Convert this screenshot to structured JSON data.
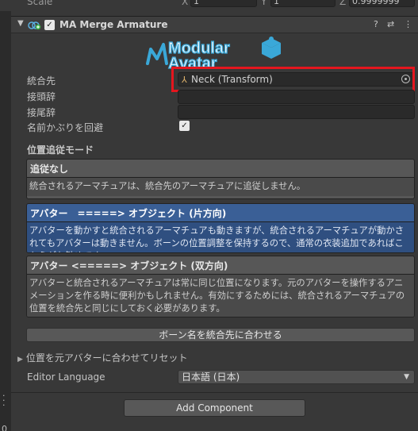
{
  "transform": {
    "scale_label": "Scale",
    "x_label": "X",
    "x_value": "1",
    "y_label": "Y",
    "y_value": "1",
    "z_label": "Z",
    "z_value": "0.9999999"
  },
  "component": {
    "title": "MA Merge Armature",
    "enabled": "✓",
    "help_icon": "?",
    "settings_icon": "⇄",
    "menu_icon": "⋮"
  },
  "logo": {
    "line1": "Modular",
    "line2": "Avatar",
    "color": "#3aa8d8"
  },
  "properties": {
    "target_label": "統合先",
    "target_value": "Neck (Transform)",
    "prefix_label": "接頭辞",
    "prefix_value": "",
    "suffix_label": "接尾辞",
    "suffix_value": "",
    "avoid_label": "名前かぶりを回避",
    "avoid_checked": "✓"
  },
  "position_mode": {
    "heading": "位置追従モード",
    "options": [
      {
        "title": "追従なし",
        "description": "統合されるアーマチュアは、統合先のアーマチュアに追従しません。",
        "selected": false
      },
      {
        "title": "アバター　=====> オブジェクト (片方向)",
        "description": "アバターを動かすと統合されるアーマチュアも動きますが、統合されるアーマチュアが動かされてもアバターは動きません。ボーンの位置調整を保持するので、通常の衣装追加であればこちらがお勧めです。",
        "selected": true
      },
      {
        "title": "アバター <=====> オブジェクト (双方向)",
        "description": "アバターと統合されるアーマチュアは常に同じ位置になります。元のアバターを操作するアニメーションを作る時に便利かもしれません。有効にするためには、統合されるアーマチュアの位置を統合先と同じにしておく必要があります。",
        "selected": false
      }
    ]
  },
  "rename_button": "ボーン名を統合先に合わせる",
  "reset_foldout": "位置を元アバターに合わせてリセット",
  "editor_language": {
    "label": "Editor Language",
    "value": "日本語 (日本)"
  },
  "add_component": "Add Component",
  "left_strip": {
    "value": "0"
  },
  "colors": {
    "selected_mode": "#3a5f96",
    "highlight": "#e5161e",
    "background": "#383838"
  }
}
